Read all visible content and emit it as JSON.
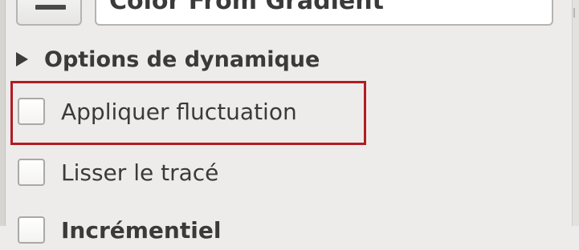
{
  "brush": {
    "combo_value": "Color From Gradient",
    "combo_icon": "gradient-icon"
  },
  "dynamics": {
    "expander_label": "Options de dynamique",
    "expander_icon": "triangle-right-icon"
  },
  "options": [
    {
      "label": "Appliquer fluctuation",
      "checked": false,
      "highlighted": true
    },
    {
      "label": "Lisser le tracé",
      "checked": false
    },
    {
      "label": "Incrémentiel",
      "checked": false
    }
  ],
  "colors": {
    "highlight": "#b01c24",
    "background": "#edecea"
  }
}
